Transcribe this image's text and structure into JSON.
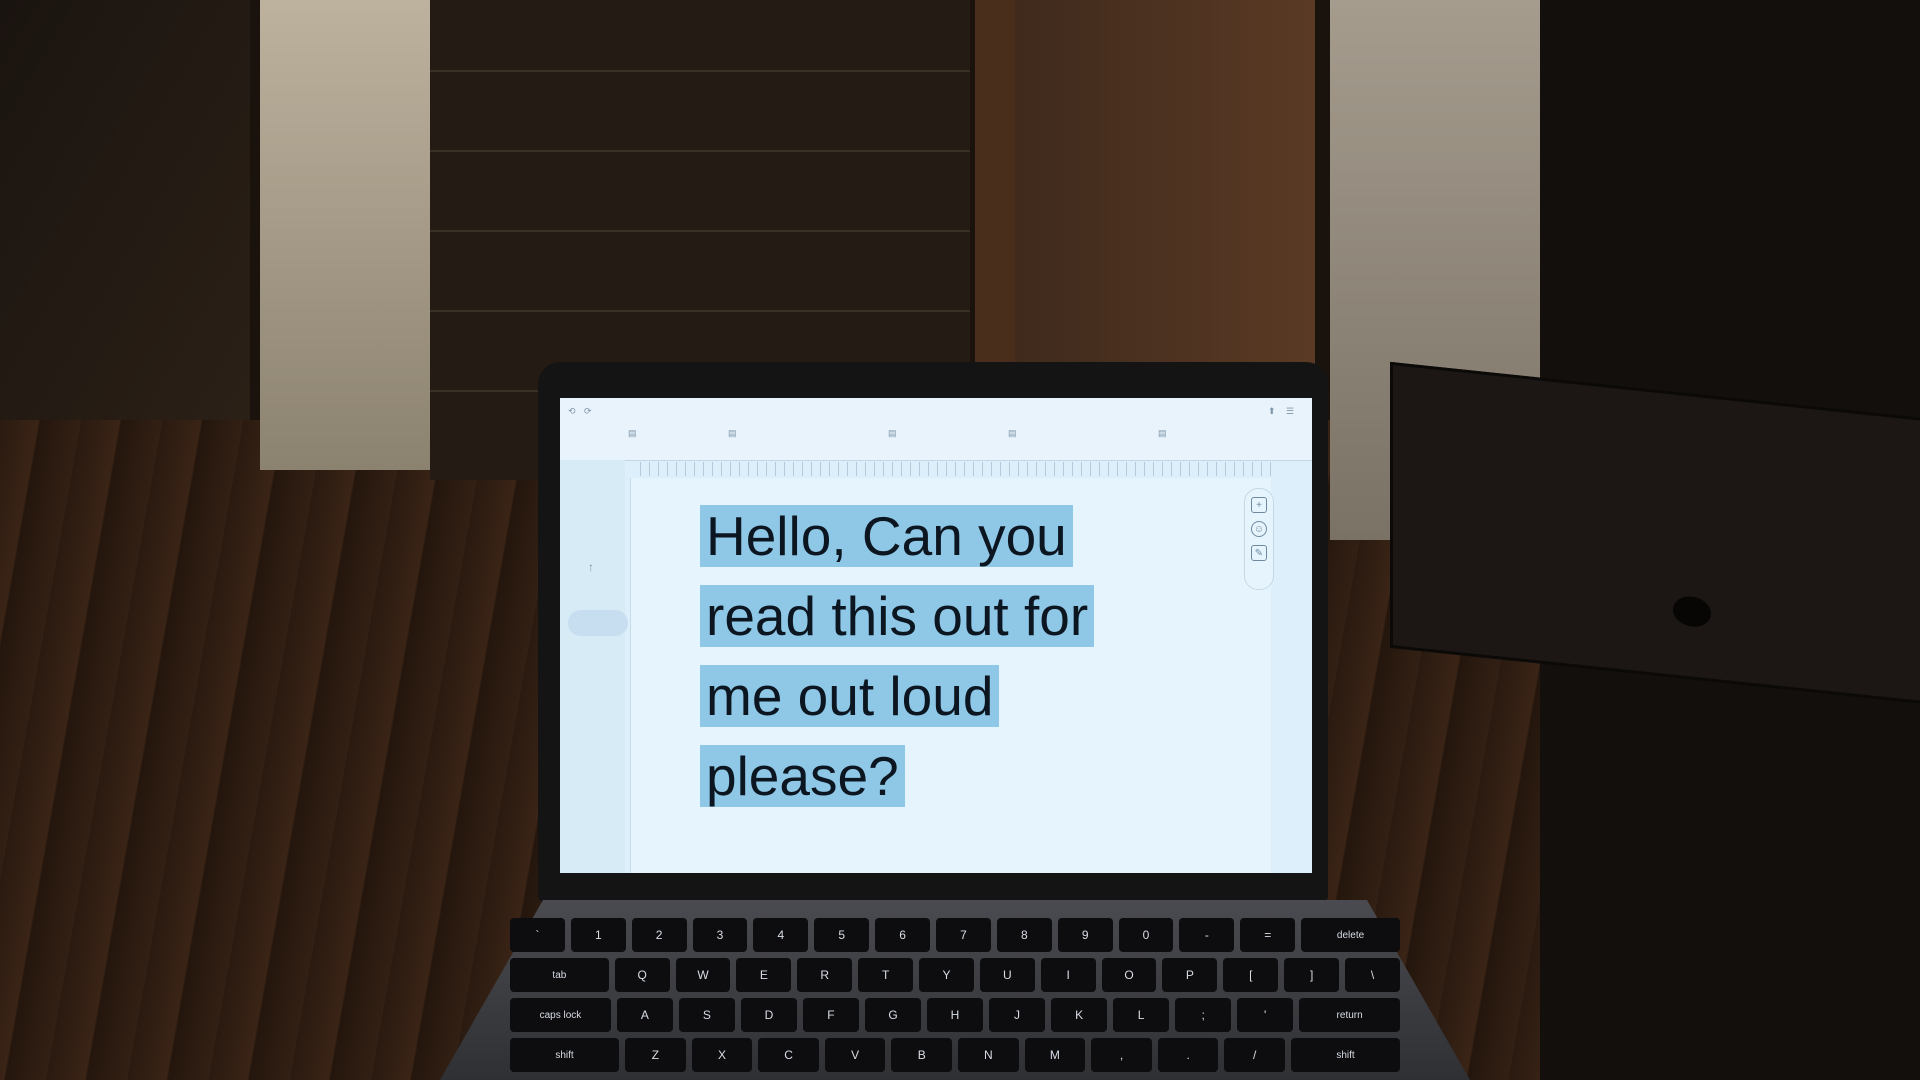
{
  "document": {
    "lines": [
      "Hello, Can you",
      "read this out for",
      "me out loud",
      "please?"
    ]
  },
  "keyboard": {
    "row1": [
      "`",
      "1",
      "2",
      "3",
      "4",
      "5",
      "6",
      "7",
      "8",
      "9",
      "0",
      "-",
      "=",
      "delete"
    ],
    "row2": [
      "tab",
      "Q",
      "W",
      "E",
      "R",
      "T",
      "Y",
      "U",
      "I",
      "O",
      "P",
      "[",
      "]",
      "\\"
    ],
    "row3": [
      "caps lock",
      "A",
      "S",
      "D",
      "F",
      "G",
      "H",
      "J",
      "K",
      "L",
      ";",
      "'",
      "return"
    ],
    "row4": [
      "shift",
      "Z",
      "X",
      "C",
      "V",
      "B",
      "N",
      "M",
      ",",
      ".",
      "/",
      "shift"
    ]
  },
  "colors": {
    "highlight": "#8fc7e6",
    "page": "#e6f5fd",
    "toolbar": "#e9f3fb"
  }
}
